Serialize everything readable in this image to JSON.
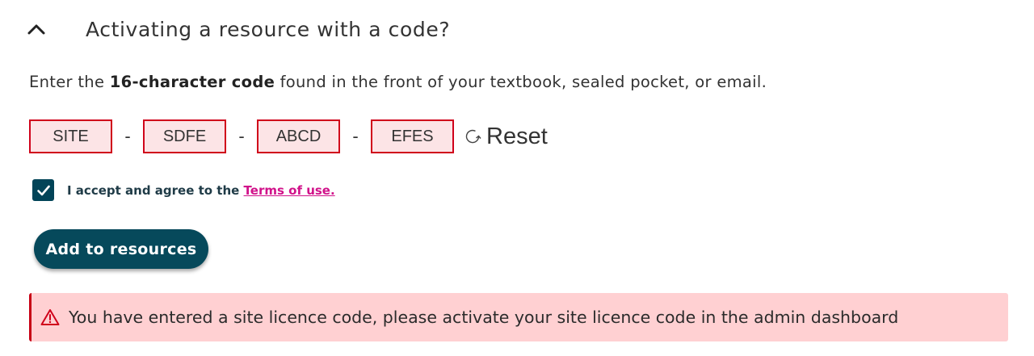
{
  "accordion": {
    "title": "Activating a resource with a code?",
    "icon": "chevron-up-icon",
    "expanded": true
  },
  "instruction": {
    "prefix": "Enter the ",
    "bold": "16-character code",
    "suffix": " found in the front of your textbook, sealed pocket, or email."
  },
  "code": {
    "segments": [
      "SITE",
      "SDFE",
      "ABCD",
      "EFES"
    ],
    "separator": "-",
    "error_state": true,
    "reset_label": "Reset",
    "reset_icon": "refresh-icon"
  },
  "terms": {
    "checked": true,
    "text": "I accept and agree to the ",
    "link_label": "Terms of use."
  },
  "submit": {
    "label": "Add to resources"
  },
  "alert": {
    "icon": "warning-triangle-icon",
    "message": "You have entered a site licence code, please activate your site licence code in the admin dashboard"
  },
  "colors": {
    "error_border": "#d0021b",
    "error_fill": "#fce4e6",
    "primary": "#06495b",
    "link": "#d1128a",
    "alert_bg": "#ffd0d2",
    "alert_accent": "#c70015"
  }
}
